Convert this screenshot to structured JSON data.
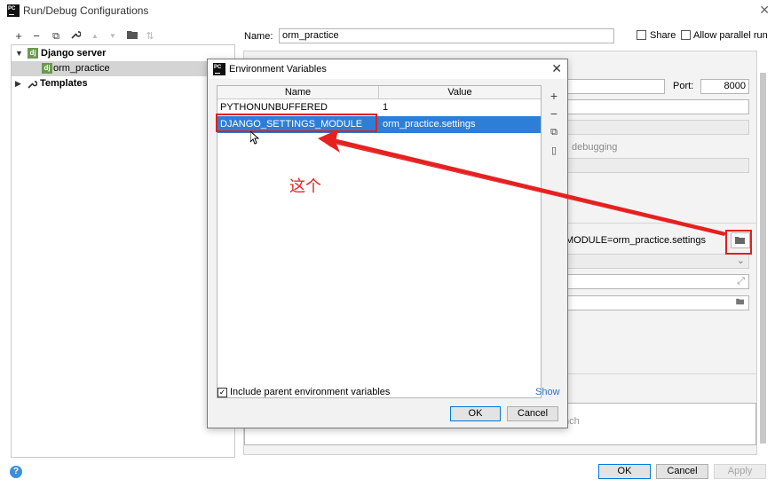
{
  "window": {
    "title": "Run/Debug Configurations",
    "close_icon": "close-icon",
    "app_badge": "PC"
  },
  "toolbar": {
    "buttons": [
      {
        "icon": "plus-icon",
        "glyph": "+"
      },
      {
        "icon": "minus-icon",
        "glyph": "−"
      },
      {
        "icon": "copy-icon",
        "glyph": "⧉"
      },
      {
        "icon": "wrench-icon",
        "glyph": "🔧"
      },
      {
        "icon": "arrow-up-icon",
        "glyph": "▲"
      },
      {
        "icon": "arrow-down-icon",
        "glyph": "▼"
      },
      {
        "icon": "folder-icon",
        "glyph": "▆"
      },
      {
        "icon": "sort-icon",
        "glyph": "⇅"
      }
    ]
  },
  "tree": {
    "django_server": "Django server",
    "orm_practice": "orm_practice",
    "templates": "Templates",
    "dj_icon_text": "dj"
  },
  "config": {
    "name_label": "Name:",
    "name_value": "orm_practice",
    "share_label": "Share",
    "allow_parallel_label": "Allow parallel run"
  },
  "background": {
    "port_label": "Port:",
    "port_value": "8000",
    "debugging_text": "debugging",
    "env_partial": "MODULE=orm_practice.settings",
    "nch_partial": "nch"
  },
  "dialog": {
    "title": "Environment Variables",
    "columns": {
      "name": "Name",
      "value": "Value"
    },
    "rows": [
      {
        "name": "PYTHONUNBUFFERED",
        "value": "1"
      },
      {
        "name": "DJANGO_SETTINGS_MODULE",
        "value": "orm_practice.settings"
      }
    ],
    "include_label": "Include parent environment variables",
    "show_link": "Show",
    "ok_label": "OK",
    "cancel_label": "Cancel",
    "side_buttons": [
      {
        "icon": "add-icon",
        "glyph": "+"
      },
      {
        "icon": "remove-icon",
        "glyph": "−"
      },
      {
        "icon": "copy-icon",
        "glyph": "⧉"
      },
      {
        "icon": "paste-icon",
        "glyph": "▯"
      }
    ]
  },
  "footer": {
    "ok_label": "OK",
    "cancel_label": "Cancel",
    "apply_label": "Apply",
    "help_glyph": "?"
  },
  "annotation": {
    "text": "这个",
    "color": "#e62020"
  },
  "colors": {
    "selection_blue": "#2d7ed6",
    "accent_red": "#e02020",
    "django_green": "#6a9a4c"
  }
}
